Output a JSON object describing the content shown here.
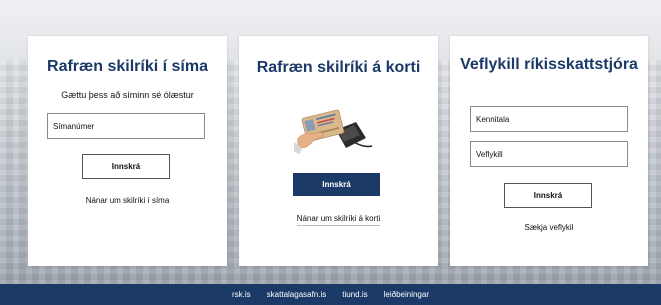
{
  "cards": {
    "phone": {
      "title": "Rafræn skilríki í síma",
      "subtitle": "Gættu þess að síminn sé ólæstur",
      "phone_placeholder": "Símanúmer",
      "login_label": "Innskrá",
      "info_link": "Nánar um skilríki í síma"
    },
    "card": {
      "title": "Rafræn skilríki á korti",
      "login_label": "Innskrá",
      "info_link": "Nánar um skilríki á korti"
    },
    "webkey": {
      "title": "Veflykill ríkisskattstjóra",
      "kennitala_placeholder": "Kennitala",
      "veflykill_placeholder": "Veflykill",
      "login_label": "Innskrá",
      "request_link": "Sækja veflykil"
    }
  },
  "footer": {
    "links": [
      "rsk.is",
      "skattalagasafn.is",
      "tiund.is",
      "leiðbeiningar"
    ]
  },
  "colors": {
    "brand_navy": "#1b3a68",
    "card_bg": "#ffffff"
  }
}
